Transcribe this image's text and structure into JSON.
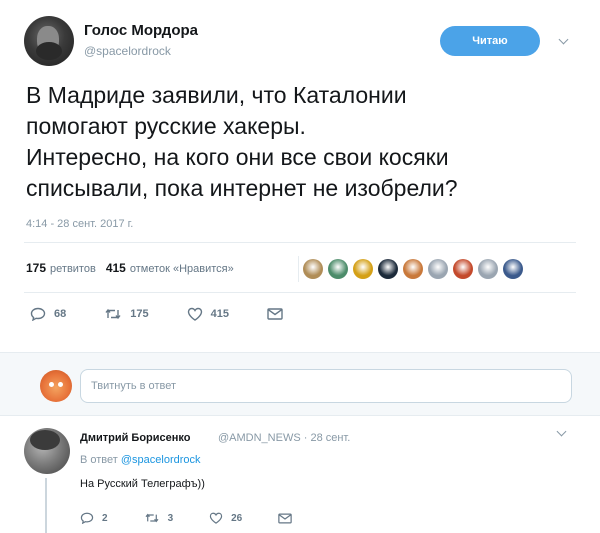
{
  "tweet": {
    "author_name": "Голос Мордора",
    "author_handle": "@spacelordrock",
    "follow_label": "Читаю",
    "text": "В Мадриде заявили, что Каталонии\nпомогают русские хакеры.\nИнтересно, на кого они все свои косяки\nсписывали, пока интернет не изобрели?",
    "timestamp": "4:14 - 28 сент. 2017 г.",
    "stats": {
      "retweets_count": "175",
      "retweets_label": "ретвитов",
      "likes_count": "415",
      "likes_label": "отметок «Нравится»"
    },
    "likers": [
      {
        "color": "#b08d57"
      },
      {
        "color": "#4c8c6a"
      },
      {
        "color": "#d4a017"
      },
      {
        "color": "#1c2a3a"
      },
      {
        "color": "#c9793b"
      },
      {
        "color": "#9aa5b1"
      },
      {
        "color": "#c44a2c"
      },
      {
        "color": "#9aa5b1"
      },
      {
        "color": "#3b5a8c"
      }
    ],
    "actions": {
      "reply_count": "68",
      "retweet_count": "175",
      "like_count": "415"
    },
    "colors": {
      "accent": "#4ba3e8",
      "muted": "#8899a6",
      "link": "#1b95e0"
    }
  },
  "reply_box": {
    "placeholder": "Твитнуть в ответ"
  },
  "reply": {
    "author_name": "Дмитрий Борисенко",
    "meta": "@AMDN_NEWS · 28 сент.",
    "in_reply_prefix": "В ответ",
    "in_reply_handle": "@spacelordrock",
    "text": "На Русский Телеграфъ))",
    "actions": {
      "reply_count": "2",
      "retweet_count": "3",
      "like_count": "26"
    }
  }
}
